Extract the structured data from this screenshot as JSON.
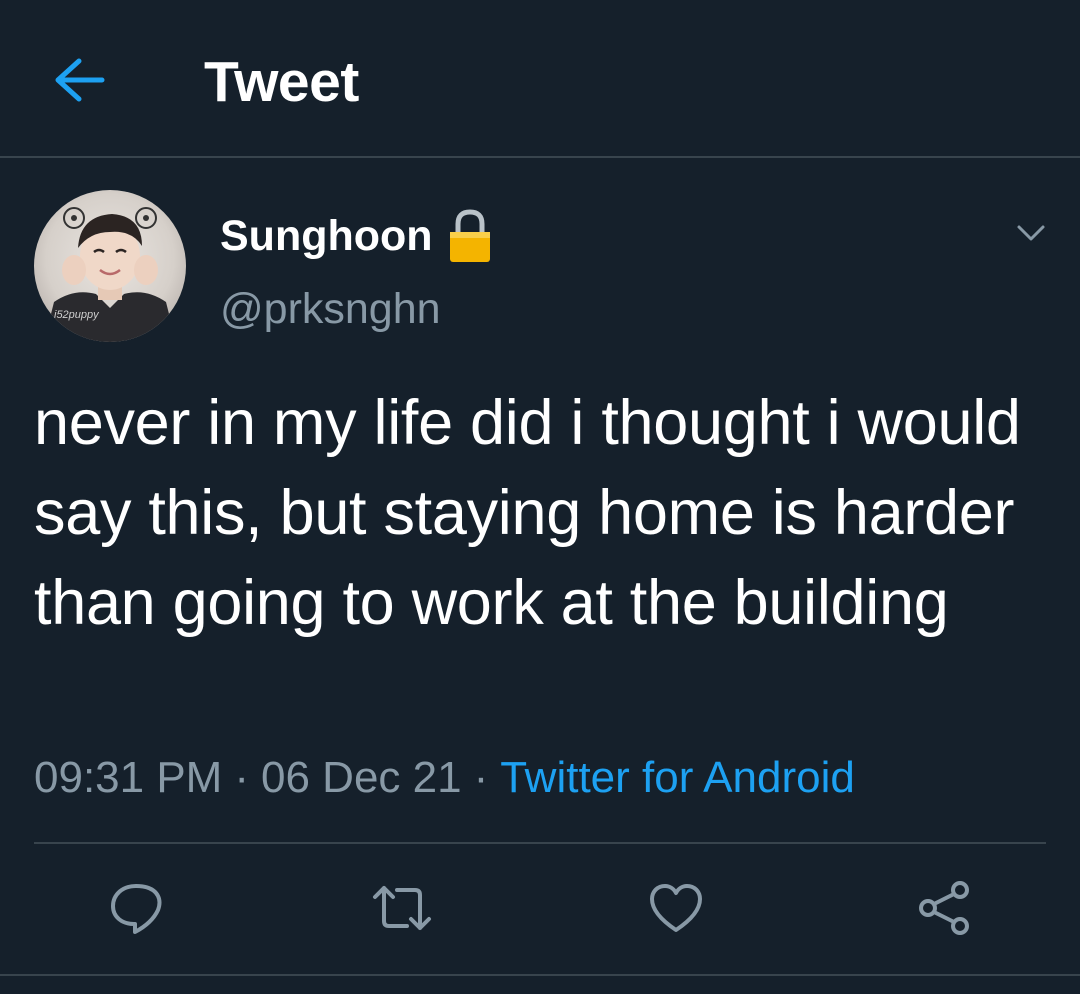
{
  "header": {
    "title": "Tweet",
    "back_icon": "arrow-left-icon",
    "accent_color": "#1da1f2"
  },
  "tweet": {
    "author": {
      "display_name": "Sunghoon",
      "handle": "@prksnghn",
      "protected_icon": "lock-icon",
      "avatar_watermark": "i52puppy"
    },
    "text": "never in my life did i thought i would say this, but staying home is harder than going to work at the building",
    "time": "09:31 PM",
    "date": "06 Dec 21",
    "separator": "·",
    "source": "Twitter for Android"
  },
  "actions": [
    {
      "icon": "reply-icon"
    },
    {
      "icon": "retweet-icon"
    },
    {
      "icon": "like-icon"
    },
    {
      "icon": "share-icon"
    }
  ],
  "colors": {
    "background": "#15202b",
    "border": "#38444d",
    "secondary_text": "#8899a6",
    "link": "#1da1f2"
  }
}
